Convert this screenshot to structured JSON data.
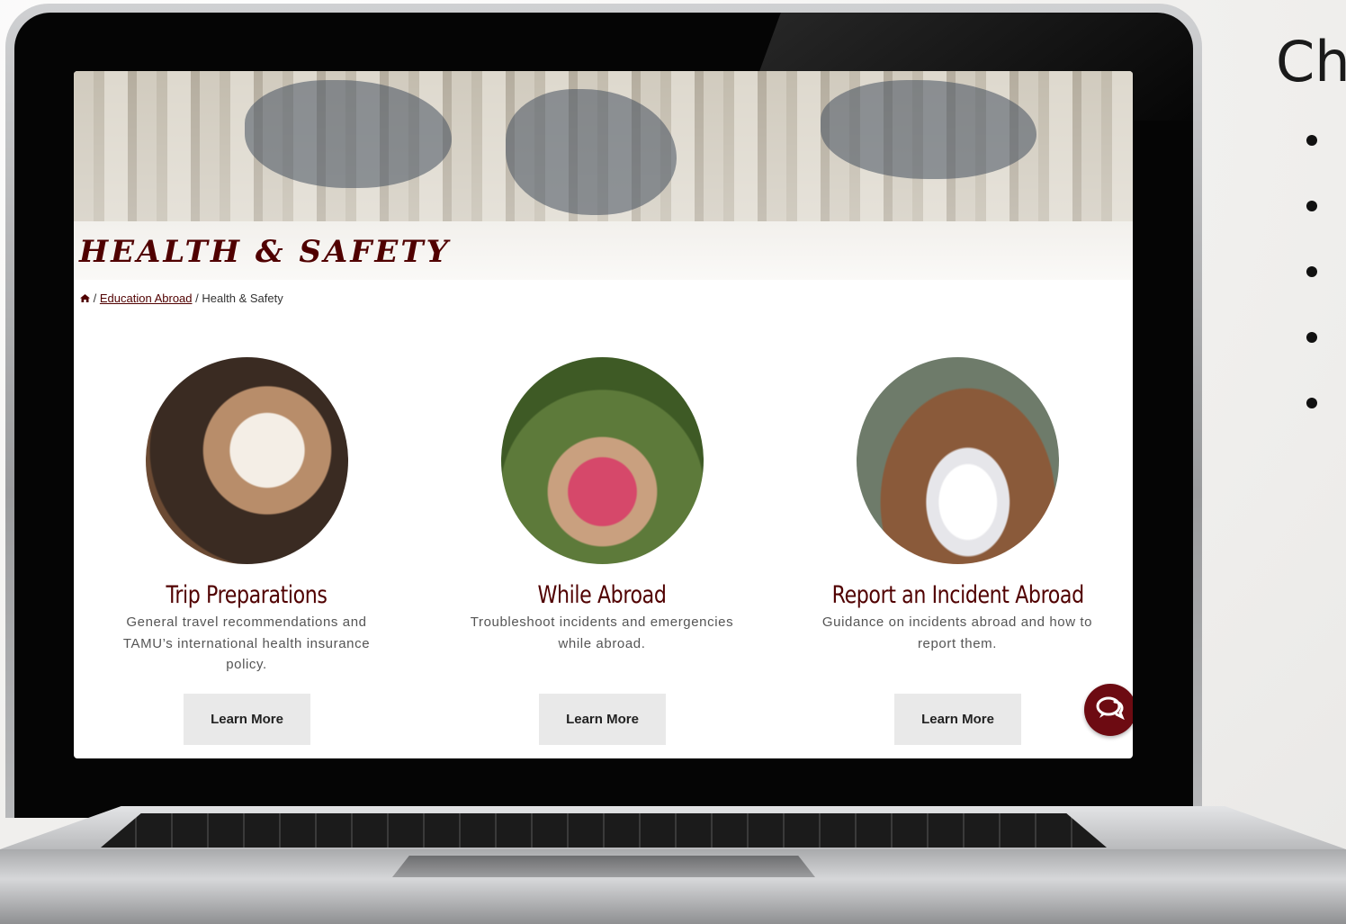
{
  "slide": {
    "heading": "Ch",
    "bullet_count": 5
  },
  "page": {
    "title": "HEALTH & SAFETY",
    "breadcrumb": {
      "home_icon": "home-icon",
      "separator": "/",
      "link": "Education Abroad",
      "current": "Health & Safety"
    }
  },
  "cards": [
    {
      "title": "Trip Preparations",
      "description": "General travel recommendations and TAMU’s international health insurance policy.",
      "button": "Learn More"
    },
    {
      "title": "While Abroad",
      "description": "Troubleshoot incidents and emergencies while abroad.",
      "button": "Learn More"
    },
    {
      "title": "Report an Incident Abroad",
      "description": "Guidance on incidents abroad and how to report them.",
      "button": "Learn More"
    }
  ],
  "chat": {
    "icon": "chat-bubbles-icon"
  },
  "colors": {
    "maroon": "#500000",
    "button_bg": "#e9e9e9"
  }
}
